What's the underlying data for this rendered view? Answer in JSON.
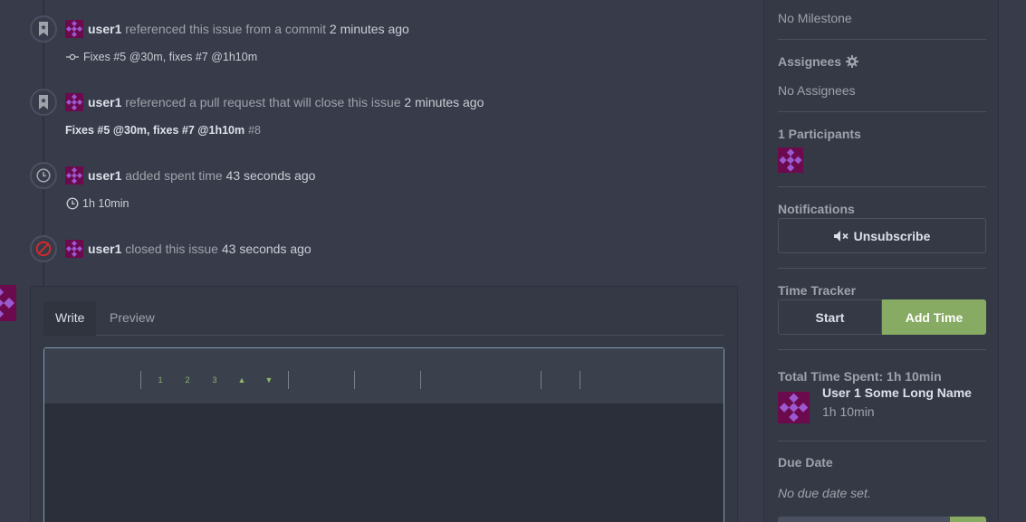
{
  "timeline": {
    "events": [
      {
        "type": "commit-ref",
        "author": "user1",
        "action": "referenced this issue from a commit",
        "time_ago": "2 minutes ago",
        "detail": "Fixes #5 @30m, fixes #7 @1h10m"
      },
      {
        "type": "pull-ref",
        "author": "user1",
        "action": "referenced a pull request that will close this issue",
        "time_ago": "2 minutes ago",
        "detail": "Fixes #5 @30m, fixes #7 @1h10m",
        "detail_ref": "#8"
      },
      {
        "type": "time",
        "author": "user1",
        "action": "added spent time",
        "time_ago": "43 seconds ago",
        "detail": "1h 10min"
      },
      {
        "type": "close",
        "author": "user1",
        "action": "closed this issue",
        "time_ago": "43 seconds ago"
      }
    ]
  },
  "comment_form": {
    "tabs": [
      "Write",
      "Preview"
    ],
    "active_tab": "Write",
    "toolbar_buttons": [
      "1",
      "2",
      "3",
      "▲",
      "▼"
    ]
  },
  "sidebar": {
    "milestone": {
      "value": "No Milestone"
    },
    "assignees": {
      "label": "Assignees",
      "value": "No Assignees"
    },
    "participants": {
      "label": "1 Participants"
    },
    "notifications": {
      "label": "Notifications",
      "button": "Unsubscribe"
    },
    "time_tracker": {
      "label": "Time Tracker",
      "start": "Start",
      "add_time": "Add Time"
    },
    "total_time": {
      "label": "Total Time Spent: 1h 10min",
      "user_name": "User 1 Some Long Name",
      "user_time": "1h 10min"
    },
    "due_date": {
      "label": "Due Date",
      "value": "No due date set."
    }
  },
  "colors": {
    "background": "#383c4a",
    "panel": "#353945",
    "accent_green": "#87ab63",
    "close_red": "#db2828",
    "avatar_bg": "#6b0a4d",
    "avatar_dots": "#9b59d0"
  }
}
